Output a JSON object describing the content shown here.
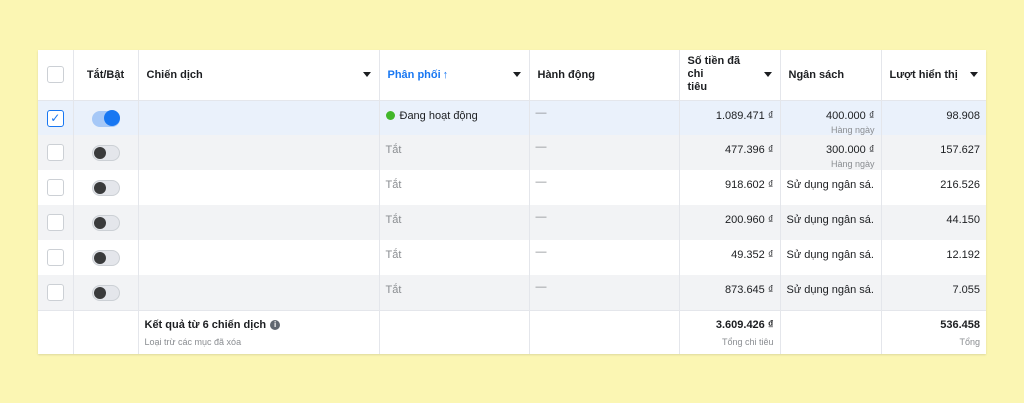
{
  "columns": {
    "toggle": "Tắt/Bật",
    "campaign": "Chiến dịch",
    "delivery": "Phân phối",
    "delivery_sort": "↑",
    "actions": "Hành động",
    "spent_line1": "Số tiền đã chi",
    "spent_line2": "tiêu",
    "budget": "Ngân sách",
    "impressions": "Lượt hiển thị"
  },
  "rows": [
    {
      "checked": true,
      "on": true,
      "delivery": "Đang hoạt động",
      "action": "—",
      "spent": "1.089.471 ₫",
      "budget": "400.000 ₫",
      "budget_sub": "Hàng ngày",
      "impressions": "98.908"
    },
    {
      "checked": false,
      "on": false,
      "delivery": "Tắt",
      "action": "—",
      "spent": "477.396 ₫",
      "budget": "300.000 ₫",
      "budget_sub": "Hàng ngày",
      "impressions": "157.627"
    },
    {
      "checked": false,
      "on": false,
      "delivery": "Tắt",
      "action": "—",
      "spent": "918.602 ₫",
      "budget": "Sử dụng ngân sá...",
      "budget_sub": "",
      "impressions": "216.526"
    },
    {
      "checked": false,
      "on": false,
      "delivery": "Tắt",
      "action": "—",
      "spent": "200.960 ₫",
      "budget": "Sử dụng ngân sá...",
      "budget_sub": "",
      "impressions": "44.150"
    },
    {
      "checked": false,
      "on": false,
      "delivery": "Tắt",
      "action": "—",
      "spent": "49.352 ₫",
      "budget": "Sử dụng ngân sá...",
      "budget_sub": "",
      "impressions": "12.192"
    },
    {
      "checked": false,
      "on": false,
      "delivery": "Tắt",
      "action": "—",
      "spent": "873.645 ₫",
      "budget": "Sử dụng ngân sá...",
      "budget_sub": "",
      "impressions": "7.055"
    }
  ],
  "total": {
    "title": "Kết quả từ 6 chiến dịch",
    "subtitle": "Loại trừ các mục đã xóa",
    "spent": "3.609.426 ₫",
    "spent_label": "Tổng chi tiêu",
    "impressions": "536.458",
    "impressions_label": "Tổng"
  },
  "colors": {
    "background": "#fbf6b3",
    "accent": "#1877f2",
    "active_dot": "#42b72a"
  }
}
